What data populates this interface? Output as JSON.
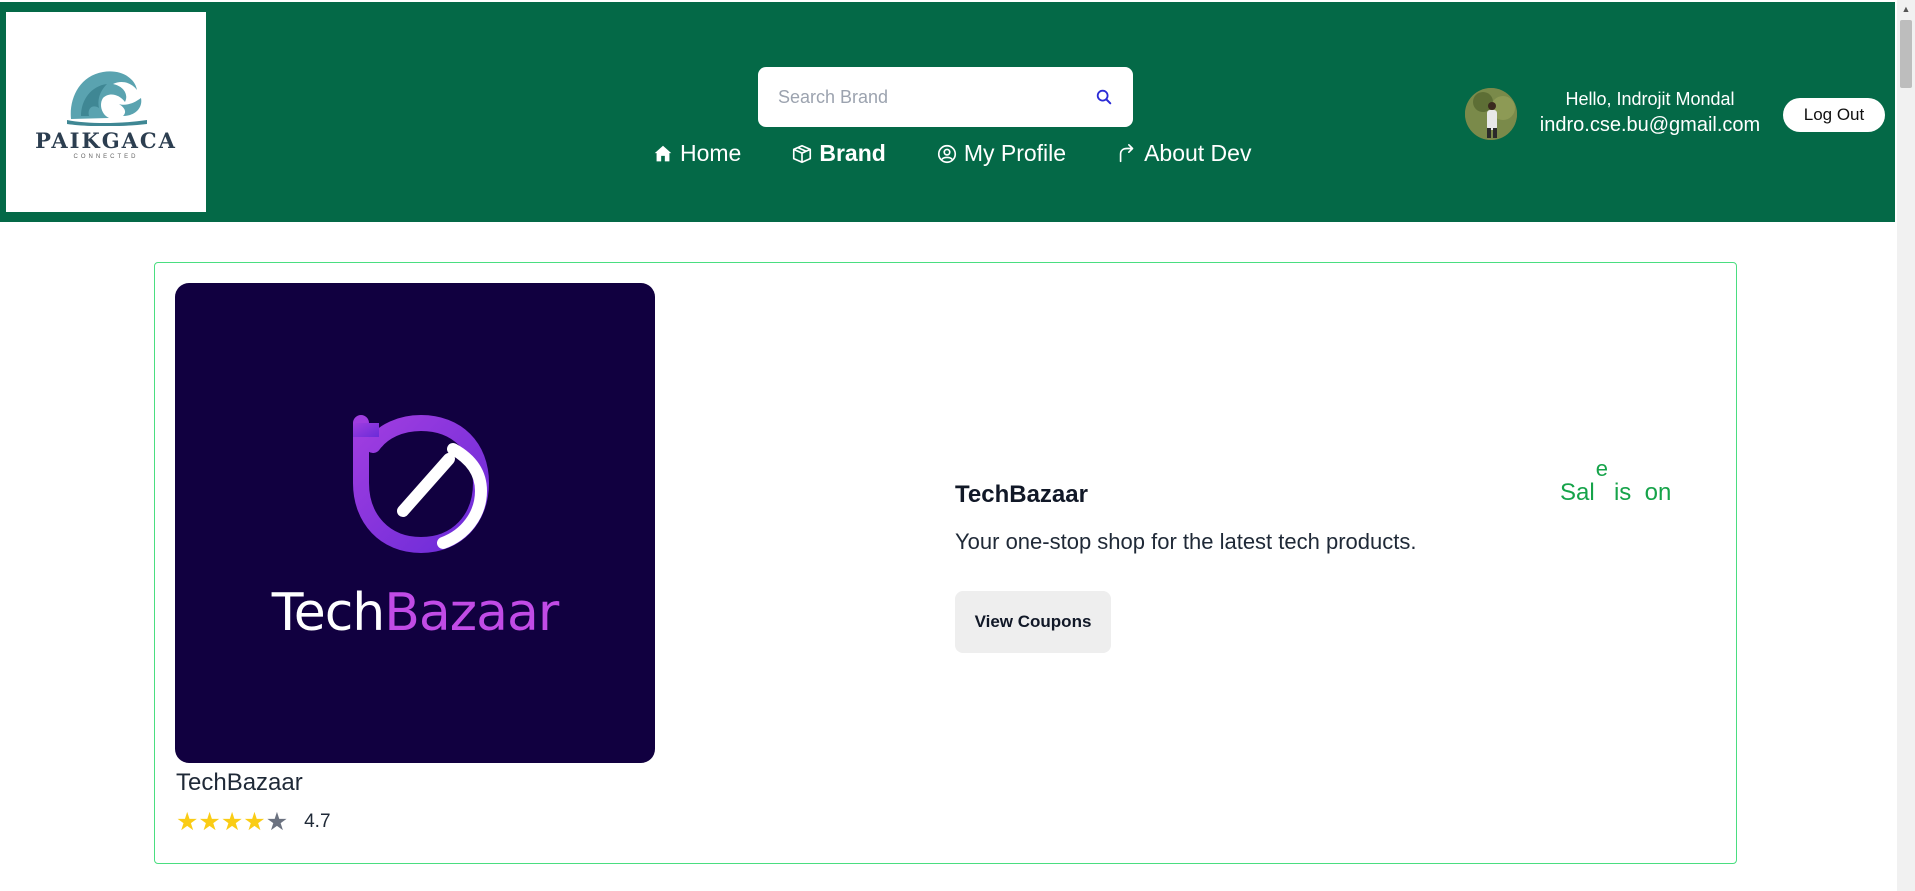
{
  "header": {
    "logo": {
      "name": "PAIKGACA",
      "sub": "CONNECTED"
    },
    "search": {
      "placeholder": "Search Brand",
      "value": ""
    },
    "nav": [
      {
        "label": "Home",
        "icon": "home-icon",
        "active": false
      },
      {
        "label": "Brand",
        "icon": "box-icon",
        "active": true
      },
      {
        "label": "My Profile",
        "icon": "user-circle-icon",
        "active": false
      },
      {
        "label": "About Dev",
        "icon": "share-arrow-icon",
        "active": false
      }
    ],
    "user": {
      "hello": "Hello, Indrojit Mondal",
      "email": "indro.cse.bu@gmail.com"
    },
    "logout_label": "Log Out"
  },
  "card": {
    "image_brand_text": {
      "part1": "Tech",
      "part2": "Bazaar"
    },
    "name": "TechBazaar",
    "rating": {
      "value": "4.7",
      "stars_filled": 4,
      "stars_total": 5
    },
    "title": "TechBazaar",
    "description": "Your one-stop shop for the latest tech products.",
    "coupon_button": "View Coupons",
    "sale_text": {
      "a": "Sal",
      "b": "e",
      "c": "is",
      "d": "on"
    }
  },
  "colors": {
    "header_bg": "#046947",
    "card_border": "#4ade80",
    "sale_green": "#16a34a",
    "star_filled": "#facc15",
    "star_empty": "#6b7280",
    "brand_image_bg": "#110040",
    "brand_accent": "#c14be6"
  }
}
